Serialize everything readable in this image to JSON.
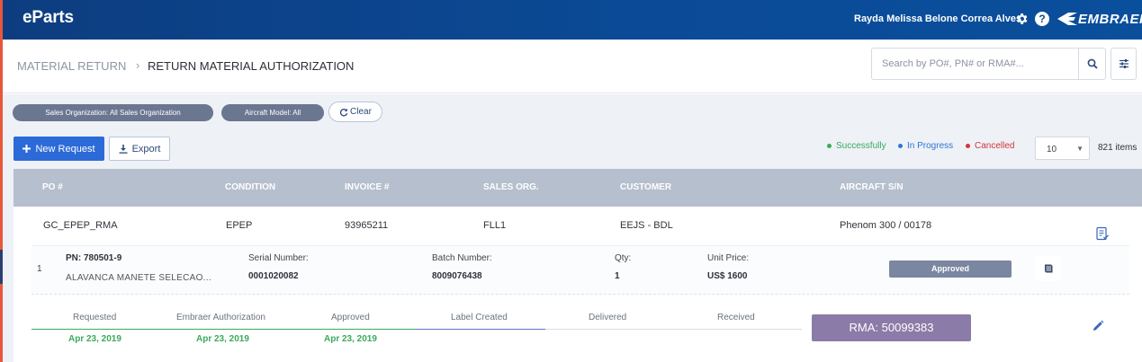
{
  "app": {
    "title": "eParts"
  },
  "topbar": {
    "user_name": "Rayda Melissa Belone Correa Alves",
    "brand": "EMBRAER",
    "settings_icon": "gear-icon",
    "help_icon": "question-circle-icon",
    "help_glyph": "?"
  },
  "breadcrumb": {
    "parent": "MATERIAL RETURN",
    "separator": "›",
    "current": "RETURN MATERIAL AUTHORIZATION"
  },
  "search": {
    "placeholder": "Search by PO#, PN# or RMA#...",
    "value": ""
  },
  "filters": {
    "sales_org_chip": "Sales Organization: All Sales Organization",
    "aircraft_model_chip": "Aircraft Model: All",
    "clear_label": "Clear"
  },
  "toolbar": {
    "new_request_label": "New Request",
    "export_label": "Export"
  },
  "legend": {
    "successfully": "Successfully",
    "in_progress": "In Progress",
    "cancelled": "Cancelled"
  },
  "pagination": {
    "page_size": "10",
    "items_count": "821 items"
  },
  "table": {
    "columns": [
      "PO #",
      "CONDITION",
      "INVOICE #",
      "SALES ORG.",
      "CUSTOMER",
      "AIRCRAFT S/N"
    ],
    "row": {
      "po": "GC_EPEP_RMA",
      "condition": "EPEP",
      "invoice": "93965211",
      "sales_org": "FLL1",
      "customer": "EEJS - BDL",
      "aircraft_sn": "Phenom 300 / 00178"
    }
  },
  "item": {
    "index": "1",
    "pn": "PN: 780501-9",
    "description": "ALAVANCA MANETE SELECAO...",
    "serial_label": "Serial Number:",
    "serial_value": "0001020082",
    "batch_label": "Batch Number:",
    "batch_value": "8009076438",
    "qty_label": "Qty:",
    "qty_value": "1",
    "unit_price_label": "Unit Price:",
    "unit_price_value": "US$ 1600",
    "status": "Approved"
  },
  "timeline": {
    "steps": [
      {
        "label": "Requested",
        "date": "Apr 23, 2019"
      },
      {
        "label": "Embraer Authorization",
        "date": "Apr 23, 2019"
      },
      {
        "label": "Approved",
        "date": "Apr 23, 2019"
      },
      {
        "label": "Label Created",
        "date": ""
      },
      {
        "label": "Delivered",
        "date": ""
      },
      {
        "label": "Received",
        "date": ""
      }
    ],
    "completed_steps": 3,
    "current_step": "Label Created"
  },
  "rma": {
    "label": "RMA: 50099383"
  },
  "colors": {
    "topbar": "#0b4a96",
    "primary_button": "#2c6ad8",
    "success": "#3aaa5c",
    "in_progress": "#2f76d2",
    "cancelled": "#d3363a",
    "rma_badge": "#8b7ba8",
    "status_approved": "#7b86a0",
    "table_header": "#b6bfce"
  }
}
